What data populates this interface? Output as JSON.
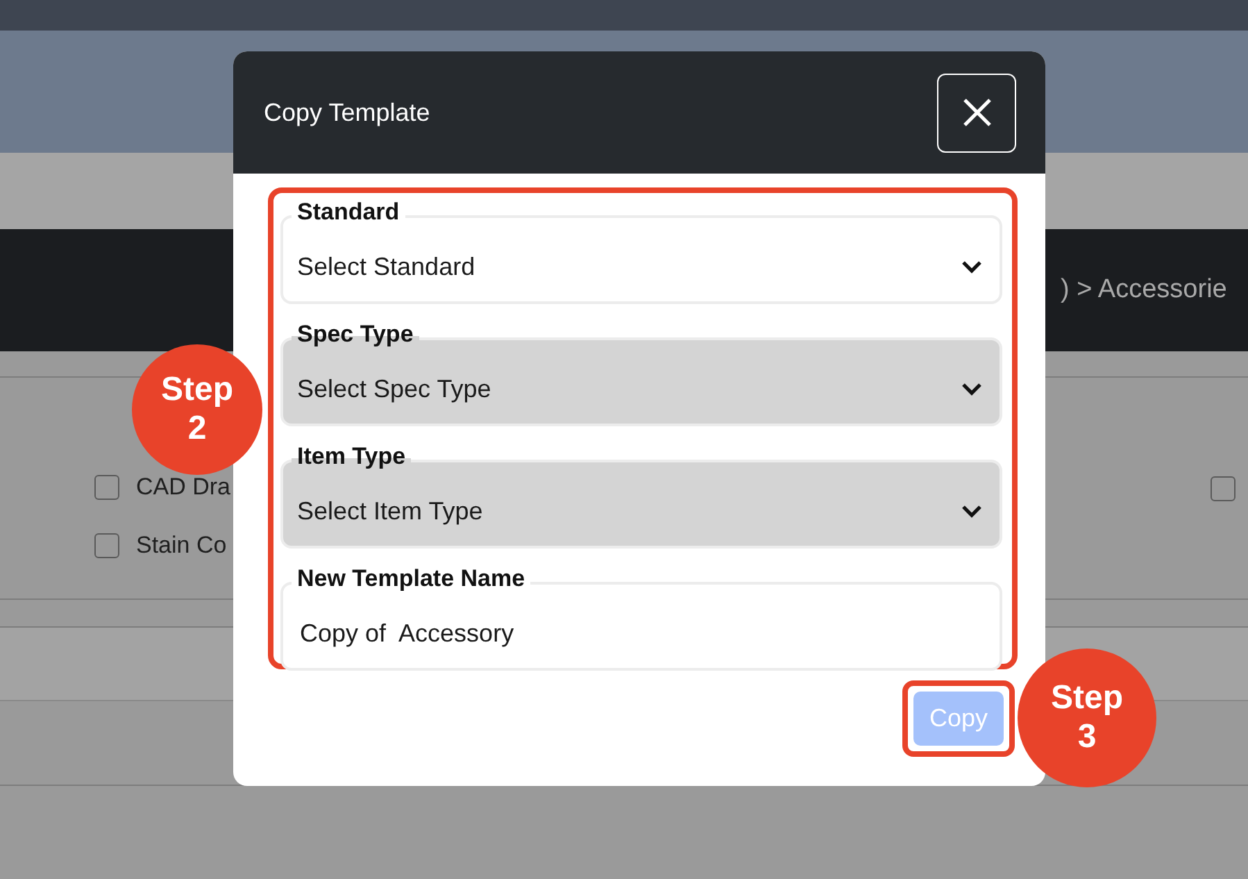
{
  "page": {
    "breadcrumb": ") > Accessorie",
    "options": [
      {
        "label": "CAD Dra",
        "checked": false
      },
      {
        "label": "Stain Co",
        "checked": false
      }
    ],
    "right_checkbox": {
      "checked": false
    }
  },
  "dialog": {
    "title": "Copy Template",
    "fields": [
      {
        "kind": "select",
        "label": "Standard",
        "placeholder": "Select Standard",
        "disabled": false
      },
      {
        "kind": "select",
        "label": "Spec Type",
        "placeholder": "Select Spec Type",
        "disabled": true
      },
      {
        "kind": "select",
        "label": "Item Type",
        "placeholder": "Select Item Type",
        "disabled": true
      },
      {
        "kind": "text",
        "label": "New Template Name",
        "value": "Copy of  Accessory"
      }
    ],
    "copy_button": {
      "label": "Copy",
      "disabled": true
    }
  },
  "annotations": [
    {
      "text": "Step 2"
    },
    {
      "text": "Step 3"
    }
  ]
}
